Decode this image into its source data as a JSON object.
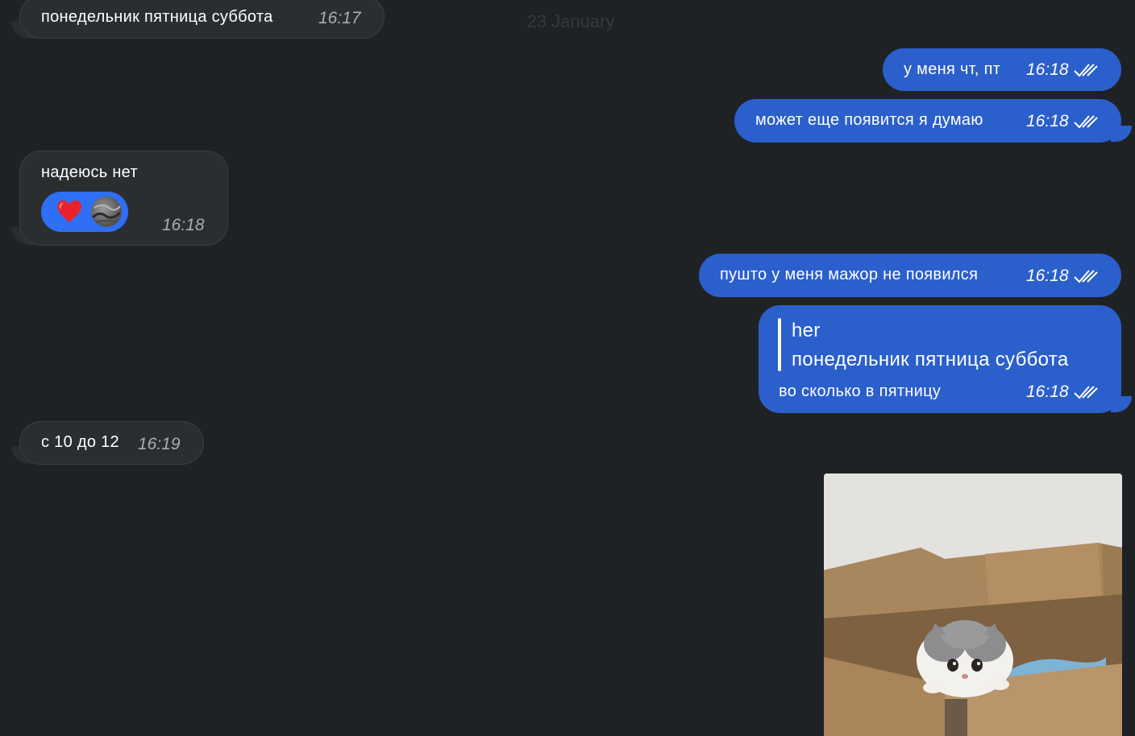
{
  "date_label": "23 January",
  "messages": [
    {
      "id": "m1",
      "side": "in",
      "text": "понедельник пятница суббота",
      "time": "16:17"
    },
    {
      "id": "m2",
      "side": "out",
      "text": "у меня чт, пт",
      "time": "16:18",
      "read": true
    },
    {
      "id": "m3",
      "side": "out",
      "text": "может еще появится я думаю",
      "time": "16:18",
      "read": true
    },
    {
      "id": "m4",
      "side": "in",
      "text": "надеюсь нет",
      "time": "16:18",
      "reaction": {
        "emoji": "heart",
        "icon": "heart-icon"
      }
    },
    {
      "id": "m5",
      "side": "out",
      "text": "пушто у меня мажор не появился",
      "time": "16:18",
      "read": true
    },
    {
      "id": "m6",
      "side": "out",
      "reply_to": {
        "author": "her",
        "text": "понедельник пятница суббота"
      },
      "text": "во сколько в пятницу",
      "time": "16:18",
      "read": true
    },
    {
      "id": "m7",
      "side": "in",
      "text": "с 10 до 12",
      "time": "16:19"
    },
    {
      "id": "m8",
      "side": "out",
      "type": "photo",
      "description_icon": "kitten-photo"
    }
  ],
  "colors": {
    "background": "#1f2225",
    "incoming_bubble": "#2b2e31",
    "outgoing_bubble": "#2b5fcb",
    "reaction_pill": "#2f6ff5",
    "timestamp_incoming": "#a9adb3"
  }
}
